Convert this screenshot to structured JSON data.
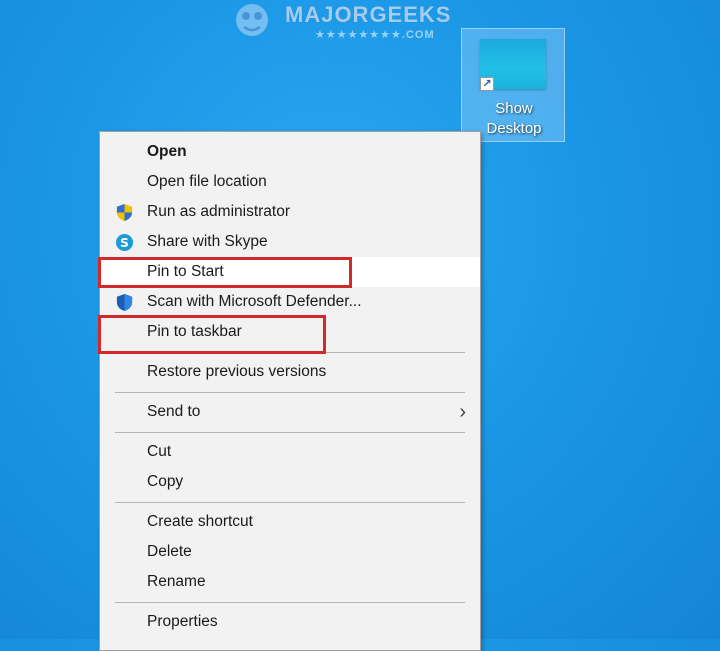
{
  "watermark": {
    "title": "MAJORGEEKS",
    "sub": "★★★★★★★★.COM"
  },
  "desktop_icon": {
    "label_line1": "Show",
    "label_line2": "Desktop",
    "icon": "shortcut-thumbnail"
  },
  "context_menu": {
    "items": [
      {
        "label": "Open",
        "bold": true
      },
      {
        "label": "Open file location"
      },
      {
        "label": "Run as administrator",
        "icon": "uac-shield-icon"
      },
      {
        "label": "Share with Skype",
        "icon": "skype-icon"
      },
      {
        "label": "Pin to Start",
        "highlighted": true
      },
      {
        "label": "Scan with Microsoft Defender...",
        "icon": "defender-icon"
      },
      {
        "label": "Pin to taskbar",
        "highlighted": true
      },
      {
        "label": "Restore previous versions"
      },
      {
        "label": "Send to",
        "submenu": true
      },
      {
        "label": "Cut"
      },
      {
        "label": "Copy"
      },
      {
        "label": "Create shortcut"
      },
      {
        "label": "Delete"
      },
      {
        "label": "Rename"
      },
      {
        "label": "Properties"
      }
    ]
  },
  "colors": {
    "desktop": "#1b97e6",
    "menu_bg": "#f2f2f2",
    "highlight_box": "#d22a2a"
  }
}
